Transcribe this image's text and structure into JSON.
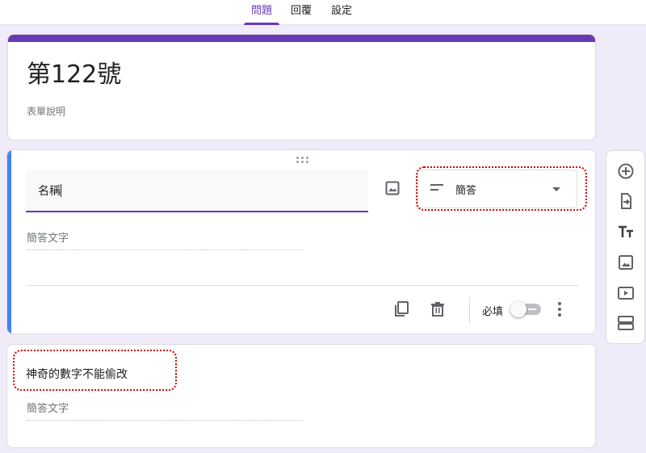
{
  "tabs": [
    {
      "label": "問題",
      "active": true
    },
    {
      "label": "回覆",
      "active": false
    },
    {
      "label": "設定",
      "active": false
    }
  ],
  "form": {
    "title": "第122號",
    "description_placeholder": "表單說明"
  },
  "active_question": {
    "title_value": "名稱",
    "question_type": "簡答",
    "answer_placeholder": "簡答文字",
    "required_label": "必填",
    "required": false
  },
  "question2": {
    "title": "神奇的數字不能偷改",
    "answer_placeholder": "簡答文字"
  },
  "toolbar": {
    "icons": [
      "add-question-icon",
      "import-questions-icon",
      "add-title-icon",
      "add-image-icon",
      "add-video-icon",
      "add-section-icon"
    ]
  },
  "colors": {
    "accent": "#673ab7",
    "active_bar": "#4285f4",
    "background": "#f0ebf8",
    "highlight": "#d50000"
  }
}
